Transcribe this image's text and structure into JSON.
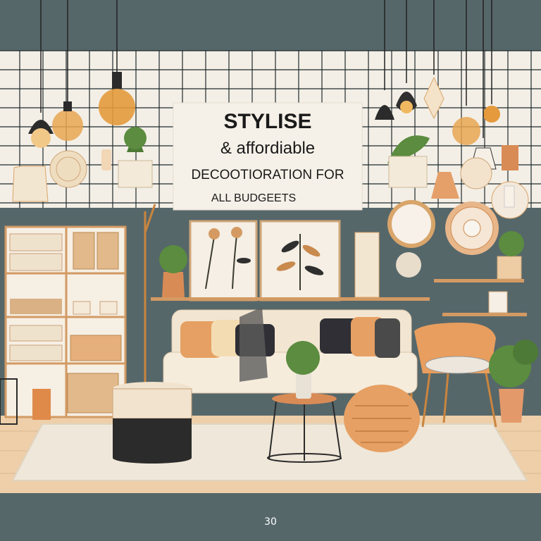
{
  "sign": {
    "line1": "STYLISE",
    "line2": "& affordiable",
    "line3": "DECOOTIORATION FOR",
    "line4": "ALL BUDGEETS"
  },
  "page_number": "30",
  "colors": {
    "wall": "#56676a",
    "tile_wall": "#f3efe6",
    "floor": "#eecfa9",
    "rug": "#efe7d9",
    "accent_orange": "#e5a06a",
    "sofa": "#f2e6d2"
  }
}
